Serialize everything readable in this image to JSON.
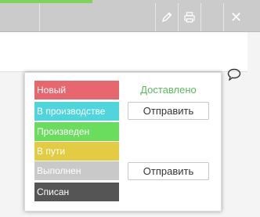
{
  "toolbar": {
    "progress_color": "#7fd35a",
    "buttons": [
      {
        "icon": "pencil-icon"
      },
      {
        "icon": "printer-icon"
      },
      {
        "icon": "close-icon"
      }
    ],
    "close_glyph": "✕"
  },
  "card": {
    "comment_icon": "comment-icon"
  },
  "popup": {
    "statuses": [
      {
        "label": "Новый",
        "color": "#e8666e"
      },
      {
        "label": "В производстве",
        "color": "#4fd6dc"
      },
      {
        "label": "Произведен",
        "color": "#6bdd5e"
      },
      {
        "label": "В пути",
        "color": "#e3cc42"
      },
      {
        "label": "Выполнен",
        "color": "#c9c9c9"
      },
      {
        "label": "Списан",
        "color": "#555555"
      }
    ],
    "delivered_label": "Доставлено",
    "send_button_1": "Отправить",
    "send_button_2": "Отправить"
  }
}
